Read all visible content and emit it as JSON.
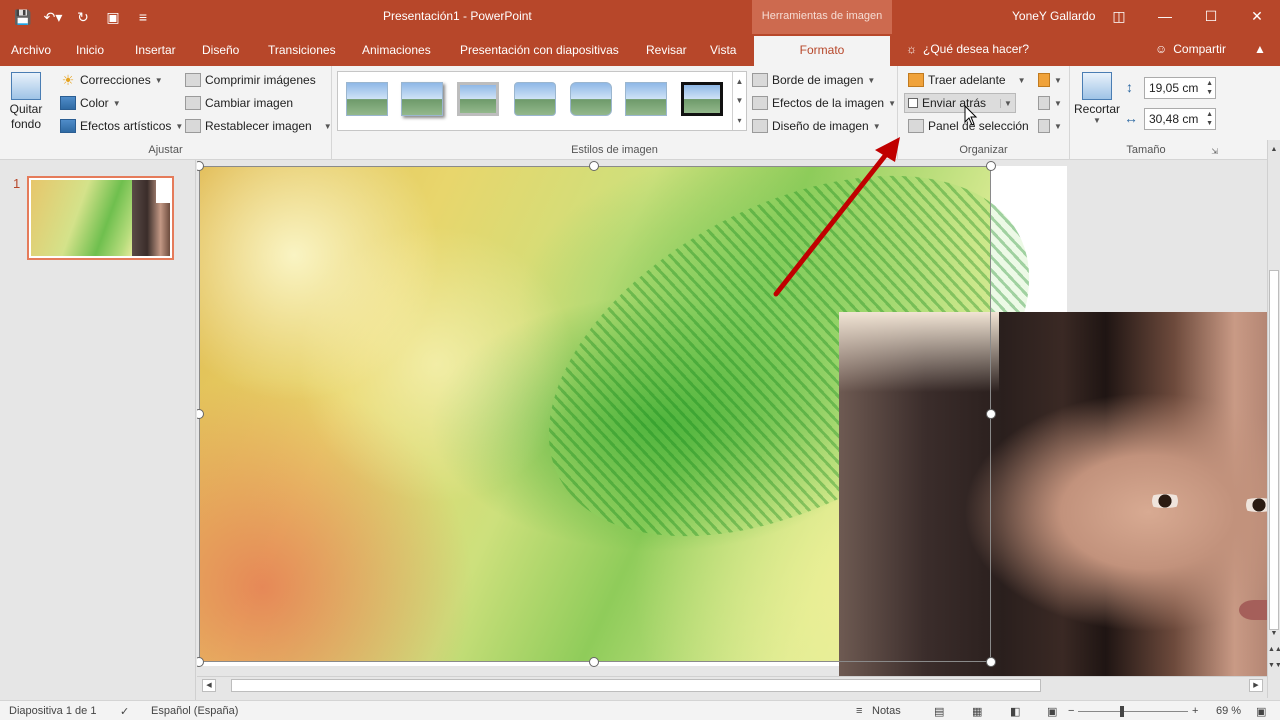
{
  "window": {
    "doc_title": "Presentación1  -  PowerPoint",
    "tools_context": "Herramientas de imagen",
    "user": "YoneY Gallardo"
  },
  "tabs": [
    {
      "label": "Archivo"
    },
    {
      "label": "Inicio"
    },
    {
      "label": "Insertar"
    },
    {
      "label": "Diseño"
    },
    {
      "label": "Transiciones"
    },
    {
      "label": "Animaciones"
    },
    {
      "label": "Presentación con diapositivas"
    },
    {
      "label": "Revisar"
    },
    {
      "label": "Vista"
    },
    {
      "label": "Formato"
    }
  ],
  "tell_me": "¿Qué desea hacer?",
  "share": "Compartir",
  "ribbon": {
    "ajustar": {
      "label": "Ajustar",
      "remove_bg": "Quitar fondo",
      "corrections": "Correcciones",
      "color": "Color",
      "artistic": "Efectos artísticos",
      "compress": "Comprimir imágenes",
      "change": "Cambiar imagen",
      "reset": "Restablecer imagen"
    },
    "styles": {
      "label": "Estilos de imagen",
      "border": "Borde de imagen",
      "effects": "Efectos de la imagen",
      "layout": "Diseño de imagen"
    },
    "organizar": {
      "label": "Organizar",
      "bring_forward": "Traer adelante",
      "send_backward": "Enviar atrás",
      "selection_pane": "Panel de selección"
    },
    "tamano": {
      "label": "Tamaño",
      "crop": "Recortar",
      "height": "19,05 cm",
      "width": "30,48 cm"
    }
  },
  "thumbnails": {
    "slide_number": "1"
  },
  "status": {
    "slide_info": "Diapositiva 1 de 1",
    "language": "Español (España)",
    "notes": "Notas",
    "zoom": "69 %"
  },
  "colors": {
    "accent": "#b7472a",
    "ribbon_bg": "#f3f3f3",
    "arrow": "#c00000"
  }
}
